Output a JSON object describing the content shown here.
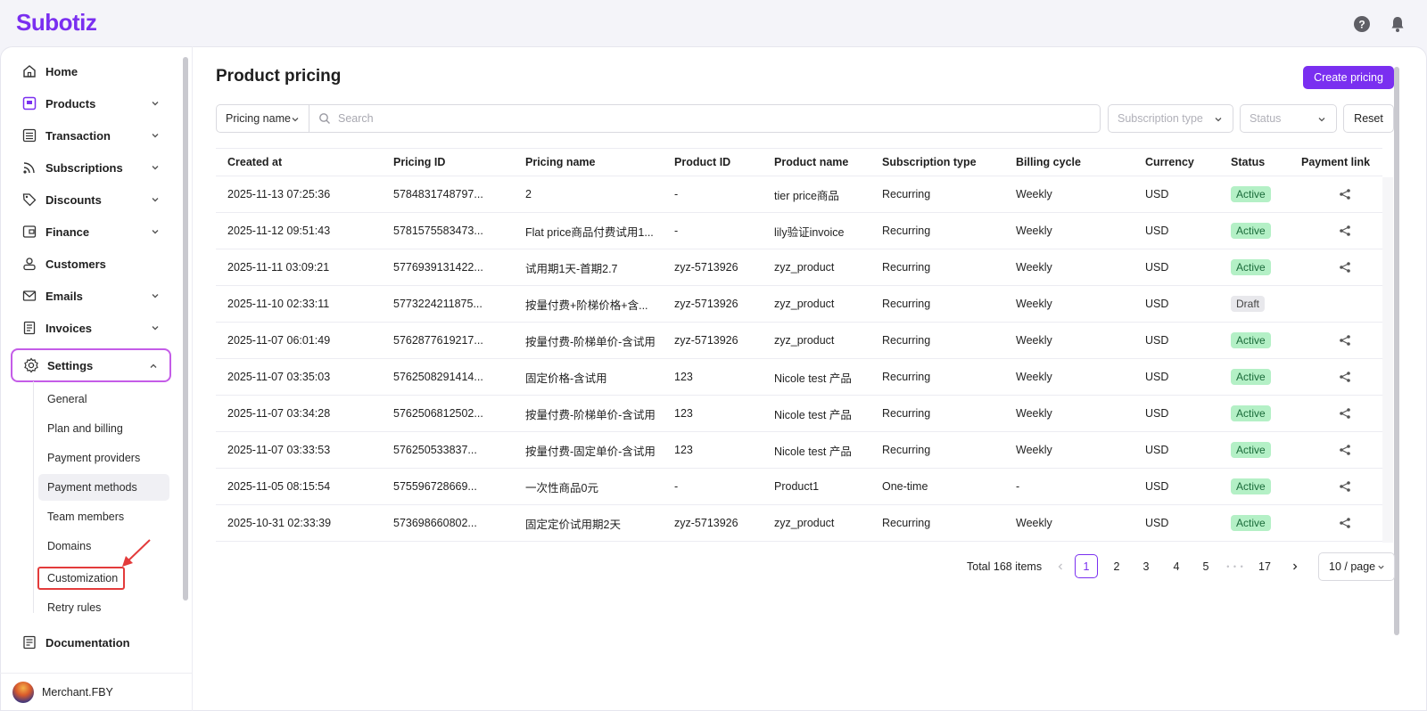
{
  "app": {
    "logo": "Subotiz"
  },
  "sidebar": {
    "items": [
      {
        "label": "Home",
        "icon": "home-icon"
      },
      {
        "label": "Products",
        "icon": "product-icon"
      },
      {
        "label": "Transaction",
        "icon": "list-icon"
      },
      {
        "label": "Subscriptions",
        "icon": "rss-icon"
      },
      {
        "label": "Discounts",
        "icon": "tag-icon"
      },
      {
        "label": "Finance",
        "icon": "wallet-icon"
      },
      {
        "label": "Customers",
        "icon": "user-icon"
      },
      {
        "label": "Emails",
        "icon": "mail-icon"
      },
      {
        "label": "Invoices",
        "icon": "invoice-icon"
      },
      {
        "label": "Settings",
        "icon": "gear-icon"
      }
    ],
    "settings_sub": [
      "General",
      "Plan and billing",
      "Payment providers",
      "Payment methods",
      "Team members",
      "Domains",
      "Customization",
      "Retry rules"
    ],
    "documentation": "Documentation",
    "user": "Merchant.FBY"
  },
  "main": {
    "title": "Product pricing",
    "create_button": "Create pricing",
    "filter_select": "Pricing name",
    "search_placeholder": "Search",
    "subscription_type_placeholder": "Subscription type",
    "status_placeholder": "Status",
    "reset_button": "Reset"
  },
  "table": {
    "headers": [
      "Created at",
      "Pricing ID",
      "Pricing name",
      "Product ID",
      "Product name",
      "Subscription type",
      "Billing cycle",
      "Currency",
      "Status",
      "Payment link"
    ],
    "rows": [
      [
        "2025-11-13 07:25:36",
        "5784831748797...",
        "2",
        "-",
        "tier price商品",
        "Recurring",
        "Weekly",
        "USD",
        "Active"
      ],
      [
        "2025-11-12 09:51:43",
        "5781575583473...",
        "Flat price商品付费试用1...",
        "-",
        "lily验证invoice",
        "Recurring",
        "Weekly",
        "USD",
        "Active"
      ],
      [
        "2025-11-11 03:09:21",
        "5776939131422...",
        "试用期1天-首期2.7",
        "zyz-5713926",
        "zyz_product",
        "Recurring",
        "Weekly",
        "USD",
        "Active"
      ],
      [
        "2025-11-10 02:33:11",
        "5773224211875...",
        "按量付费+阶梯价格+含...",
        "zyz-5713926",
        "zyz_product",
        "Recurring",
        "Weekly",
        "USD",
        "Draft"
      ],
      [
        "2025-11-07 06:01:49",
        "5762877619217...",
        "按量付费-阶梯单价-含试用",
        "zyz-5713926",
        "zyz_product",
        "Recurring",
        "Weekly",
        "USD",
        "Active"
      ],
      [
        "2025-11-07 03:35:03",
        "5762508291414...",
        "固定价格-含试用",
        "123",
        "Nicole test 产品",
        "Recurring",
        "Weekly",
        "USD",
        "Active"
      ],
      [
        "2025-11-07 03:34:28",
        "5762506812502...",
        "按量付费-阶梯单价-含试用",
        "123",
        "Nicole test 产品",
        "Recurring",
        "Weekly",
        "USD",
        "Active"
      ],
      [
        "2025-11-07 03:33:53",
        "576250533837...",
        "按量付费-固定单价-含试用",
        "123",
        "Nicole test 产品",
        "Recurring",
        "Weekly",
        "USD",
        "Active"
      ],
      [
        "2025-11-05 08:15:54",
        "575596728669...",
        "一次性商品0元",
        "-",
        "Product1",
        "One-time",
        "-",
        "USD",
        "Active"
      ],
      [
        "2025-10-31 02:33:39",
        "573698660802...",
        "固定定价试用期2天",
        "zyz-5713926",
        "zyz_product",
        "Recurring",
        "Weekly",
        "USD",
        "Active"
      ]
    ]
  },
  "pagination": {
    "total": "Total 168 items",
    "pages": [
      "1",
      "2",
      "3",
      "4",
      "5"
    ],
    "ellipsis": "• • •",
    "last": "17",
    "active": "1",
    "page_size": "10 / page"
  },
  "colors": {
    "brand": "#7a2ff0",
    "active_badge": "#b4f0c6",
    "settings_highlight": "#c45ce8",
    "annotation": "#e33b3b"
  }
}
